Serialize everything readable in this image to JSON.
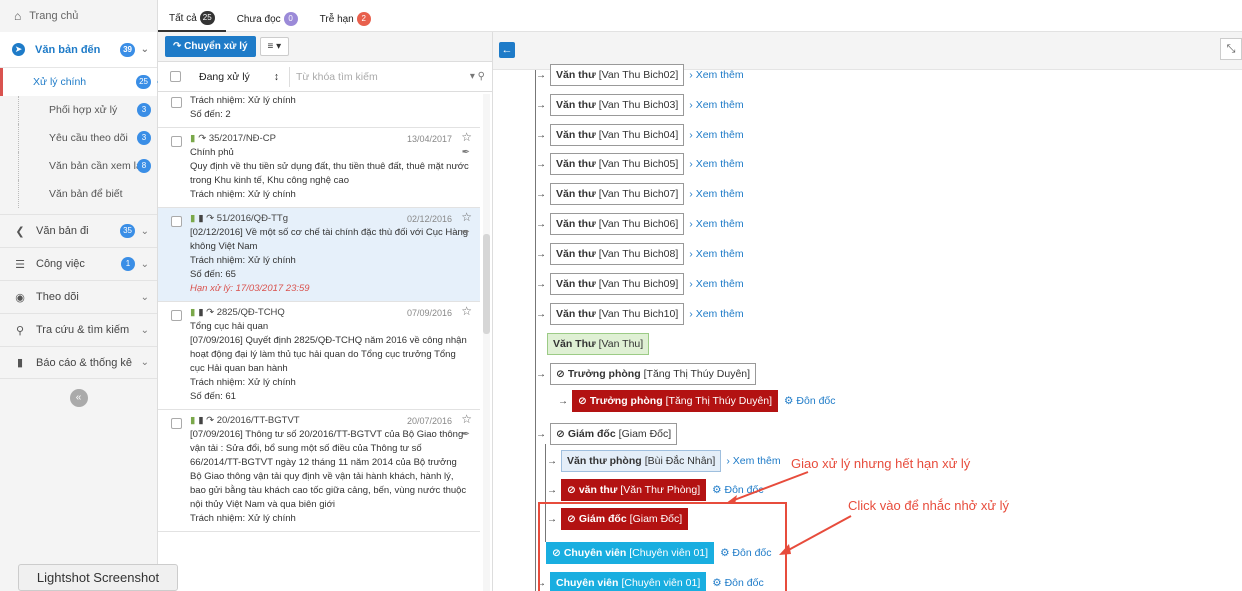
{
  "topbar": {
    "home_label": "Trang chủ",
    "tabs": [
      {
        "label": "Tất cả",
        "count": "25"
      },
      {
        "label": "Chưa đọc",
        "count": "0"
      },
      {
        "label": "Trễ hạn",
        "count": "2"
      }
    ]
  },
  "sidebar": {
    "incoming": {
      "label": "Văn bản đến",
      "count": "39"
    },
    "sub_items": [
      {
        "label": "Xử lý chính",
        "count": "25"
      },
      {
        "label": "Phối hợp xử lý",
        "count": "3"
      },
      {
        "label": "Yêu cầu theo dõi",
        "count": "3"
      },
      {
        "label": "Văn bản cần xem lại",
        "count": "8"
      },
      {
        "label": "Văn bản để biết",
        "count": ""
      }
    ],
    "items": [
      {
        "label": "Văn bản đi",
        "count": "35"
      },
      {
        "label": "Công việc",
        "count": "1"
      },
      {
        "label": "Theo dõi",
        "count": ""
      },
      {
        "label": "Tra cứu & tìm kiếm",
        "count": ""
      },
      {
        "label": "Báo cáo & thống kê",
        "count": ""
      }
    ]
  },
  "lightshot_label": "Lightshot Screenshot",
  "list_toolbar": {
    "action_label": "Chuyển xử lý",
    "menu_label": "≡ ▾"
  },
  "filter": {
    "status_value": "Đang xử lý",
    "search_placeholder": "Từ khóa tìm kiếm"
  },
  "documents": [
    {
      "code": "",
      "date": "",
      "org": "",
      "summary": "",
      "resp": "Trách nhiệm: Xử lý chính",
      "num": "Số đến: 2",
      "deadline": ""
    },
    {
      "code": "35/2017/NĐ-CP",
      "date": "13/04/2017",
      "org": "Chính phủ",
      "summary": "Quy định về thu tiền sử dụng đất, thu tiền thuê đất, thuê mặt nước trong Khu kinh tế, Khu công nghệ cao",
      "resp": "Trách nhiệm: Xử lý chính",
      "num": "",
      "deadline": ""
    },
    {
      "code": "51/2016/QĐ-TTg",
      "date": "02/12/2016",
      "org": "",
      "summary": "[02/12/2016] Về một số cơ chế tài chính đặc thù đối với Cục Hàng không Việt Nam",
      "resp": "Trách nhiệm: Xử lý chính",
      "num": "Số đến: 65",
      "deadline": "Hạn xử lý: 17/03/2017 23:59"
    },
    {
      "code": "2825/QĐ-TCHQ",
      "date": "07/09/2016",
      "org": "Tổng cục hải quan",
      "summary": "[07/09/2016] Quyết định 2825/QĐ-TCHQ năm 2016 về công nhận hoạt động đại lý làm thủ tục hải quan do Tổng cục trưởng Tổng cục Hải quan ban hành",
      "resp": "Trách nhiệm: Xử lý chính",
      "num": "Số đến: 61",
      "deadline": ""
    },
    {
      "code": "20/2016/TT-BGTVT",
      "date": "20/07/2016",
      "org": "",
      "summary": "[07/09/2016] Thông tư số 20/2016/TT-BGTVT của Bộ Giao thông vận tải : Sửa đổi, bổ sung một số điều của Thông tư số 66/2014/TT-BGTVT ngày 12 tháng 11 năm 2014 của Bộ trưởng Bộ Giao thông vận tải quy định về vận tải hành khách, hành lý, bao gửi bằng tàu khách cao tốc giữa cảng, bến, vùng nước thuộc nội thủy Việt Nam và qua biên giới",
      "resp": "Trách nhiệm: Xử lý chính",
      "num": "",
      "deadline": ""
    }
  ],
  "tree": {
    "more_label": "Xem thêm",
    "urge_label": "Đôn đốc",
    "clerks": [
      {
        "role": "Văn thư",
        "person": "[Van Thu Bich02]"
      },
      {
        "role": "Văn thư",
        "person": "[Van Thu Bich03]"
      },
      {
        "role": "Văn thư",
        "person": "[Van Thu Bich04]"
      },
      {
        "role": "Văn thư",
        "person": "[Van Thu Bich05]"
      },
      {
        "role": "Văn thư",
        "person": "[Van Thu Bich07]"
      },
      {
        "role": "Văn thư",
        "person": "[Van Thu Bich06]"
      },
      {
        "role": "Văn thư",
        "person": "[Van Thu Bich08]"
      },
      {
        "role": "Văn thư",
        "person": "[Van Thu Bich09]"
      },
      {
        "role": "Văn thư",
        "person": "[Van Thu Bich10]"
      }
    ],
    "van_thu": {
      "role": "Văn Thư",
      "person": "[Van Thu]"
    },
    "truong_phong": {
      "role": "Trưởng phòng",
      "person": "[Tăng Thị Thúy Duyên]"
    },
    "truong_phong_red": {
      "role": "Trưởng phòng",
      "person": "[Tăng Thị Thúy Duyên]"
    },
    "giam_doc": {
      "role": "Giám đốc",
      "person": "[Giam Đốc]"
    },
    "van_thu_phong": {
      "role": "Văn thư phòng",
      "person": "[Bùi Đắc Nhân]",
      "more": "Xem thêm"
    },
    "van_thu_red": {
      "role": "văn thư",
      "person": "[Văn Thư Phòng]"
    },
    "giam_doc_red": {
      "role": "Giám đốc",
      "person": "[Giam Đốc]"
    },
    "chuyen_vien_1": {
      "role": "Chuyên viên",
      "person": "[Chuyên viên 01]"
    },
    "chuyen_vien_2": {
      "role": "Chuyên viên",
      "person": "[Chuyên viên 01]"
    }
  },
  "annotations": {
    "expired": "Giao xử lý nhưng hết hạn xử lý",
    "click_remind": "Click vào để nhắc nhở xử lý"
  },
  "colors": {
    "accent": "#1e7bc8",
    "overdue_red": "#b31212",
    "annotation_red": "#e74c3c",
    "specialist_blue": "#19aee0"
  }
}
